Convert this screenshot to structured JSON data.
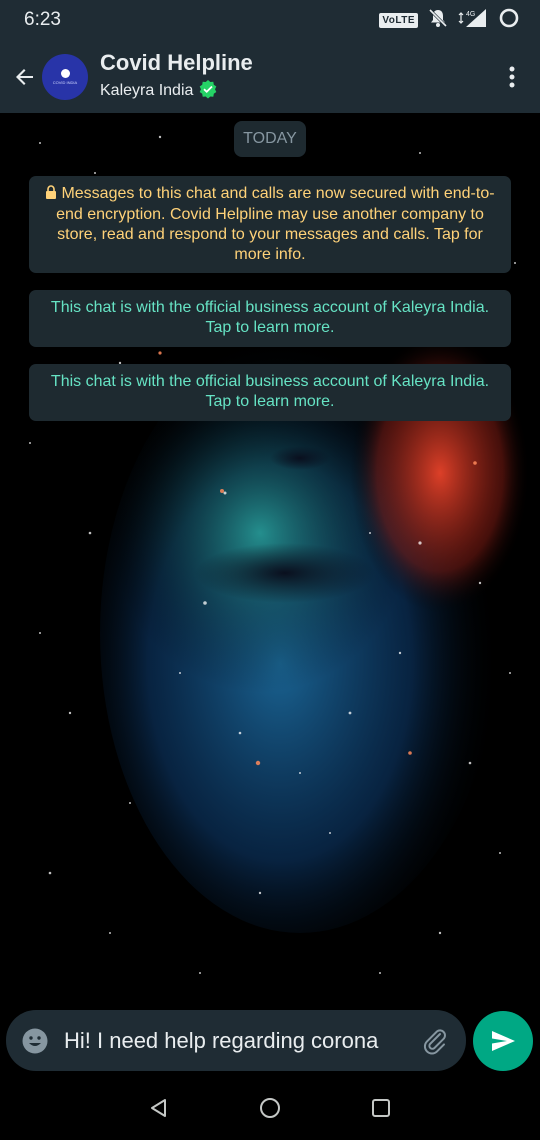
{
  "status_bar": {
    "time": "6:23",
    "volte": "VoLTE",
    "network": "4G",
    "icons": [
      "volte-icon",
      "notifications-off-icon",
      "signal-icon",
      "battery-saver-icon"
    ]
  },
  "header": {
    "title": "Covid Helpline",
    "subtitle": "Kaleyra India",
    "avatar_text": "COVID INDIA",
    "icons": [
      "back-arrow-icon",
      "verified-badge-icon",
      "more-vert-icon"
    ]
  },
  "chat": {
    "date_label": "TODAY",
    "messages": [
      {
        "type": "encryption_notice",
        "text": "Messages to this chat and calls are now secured with end-to-end encryption. Covid Helpline may use another company to store, read and respond to your messages and calls. Tap for more info."
      },
      {
        "type": "business_notice",
        "text": "This chat is with the official business account of Kaleyra India. Tap to learn more."
      },
      {
        "type": "business_notice",
        "text": "This chat is with the official business account of Kaleyra India. Tap to learn more."
      }
    ]
  },
  "composer": {
    "value": "Hi! I need help regarding corona",
    "icons": [
      "emoji-icon",
      "attachment-icon",
      "send-icon"
    ]
  },
  "colors": {
    "header_bg": "#1f2c34",
    "bubble_bg": "#1e2a30",
    "encryption_text": "#ffd279",
    "business_text": "#66e3c4",
    "send_button": "#00a884"
  }
}
